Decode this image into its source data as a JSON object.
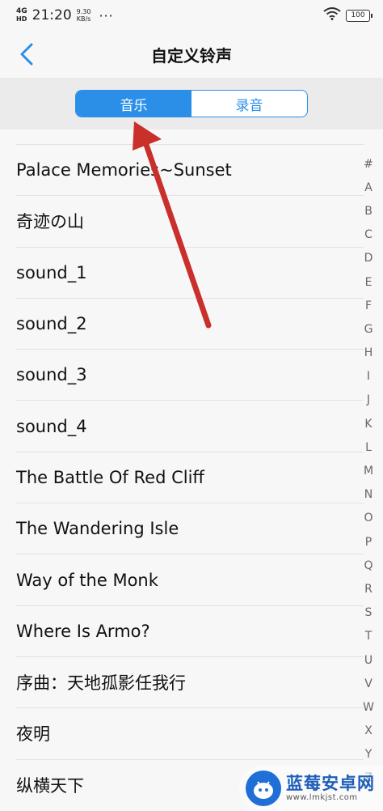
{
  "status_bar": {
    "network": "4G",
    "network_sub": "HD",
    "time": "21:20",
    "speed_value": "9.30",
    "speed_unit": "KB/s",
    "dots": "···",
    "battery": "100"
  },
  "nav": {
    "back_icon": "chevron-left-icon",
    "title": "自定义铃声"
  },
  "segment": {
    "tabs": [
      {
        "label": "音乐",
        "active": true
      },
      {
        "label": "录音",
        "active": false
      }
    ],
    "accent_color": "#2b8fe8"
  },
  "list": {
    "items": [
      "Palace Memories~Sunset",
      "奇迹の山",
      "sound_1",
      "sound_2",
      "sound_3",
      "sound_4",
      "The Battle Of Red Cliff",
      "The Wandering Isle",
      "Way of the Monk",
      "Where Is Armo?",
      "序曲：天地孤影任我行",
      "夜明",
      "纵横天下"
    ]
  },
  "index_bar": [
    "#",
    "A",
    "B",
    "C",
    "D",
    "E",
    "F",
    "G",
    "H",
    "I",
    "J",
    "K",
    "L",
    "M",
    "N",
    "O",
    "P",
    "Q",
    "R",
    "S",
    "T",
    "U",
    "V",
    "W",
    "X",
    "Y",
    "Z"
  ],
  "annotation": {
    "arrow_color": "#c9302c"
  },
  "watermark": {
    "name": "蓝莓安卓网",
    "url": "www.lmkjst.com"
  }
}
